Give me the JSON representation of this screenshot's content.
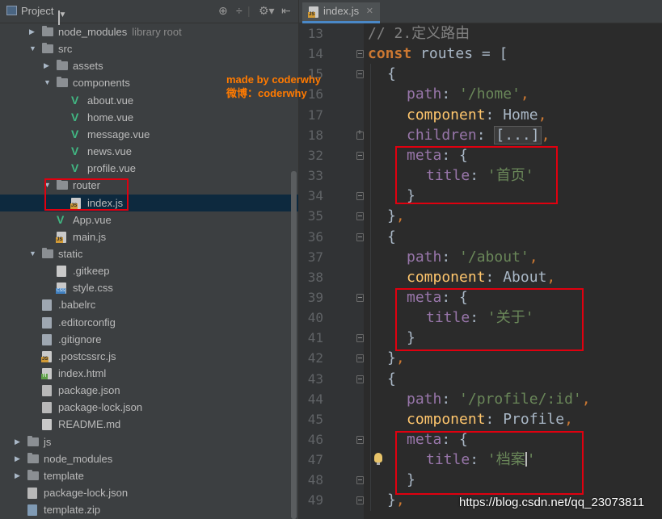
{
  "project": {
    "title": "Project",
    "tree": [
      {
        "label": "node_modules",
        "extra": "library root",
        "type": "folder",
        "depth": 1,
        "expanded": false
      },
      {
        "label": "src",
        "type": "folder",
        "depth": 1,
        "expanded": true
      },
      {
        "label": "assets",
        "type": "folder",
        "depth": 2,
        "expanded": false
      },
      {
        "label": "components",
        "type": "folder",
        "depth": 2,
        "expanded": true
      },
      {
        "label": "about.vue",
        "type": "vue",
        "depth": 3
      },
      {
        "label": "home.vue",
        "type": "vue",
        "depth": 3
      },
      {
        "label": "message.vue",
        "type": "vue",
        "depth": 3
      },
      {
        "label": "news.vue",
        "type": "vue",
        "depth": 3
      },
      {
        "label": "profile.vue",
        "type": "vue",
        "depth": 3
      },
      {
        "label": "router",
        "type": "folder",
        "depth": 2,
        "expanded": true
      },
      {
        "label": "index.js",
        "type": "js",
        "depth": 3,
        "selected": true
      },
      {
        "label": "App.vue",
        "type": "vue",
        "depth": 2
      },
      {
        "label": "main.js",
        "type": "js",
        "depth": 2
      },
      {
        "label": "static",
        "type": "folder",
        "depth": 1,
        "expanded": true
      },
      {
        "label": ".gitkeep",
        "type": "file",
        "depth": 2
      },
      {
        "label": "style.css",
        "type": "css",
        "depth": 2
      },
      {
        "label": ".babelrc",
        "type": "cfg",
        "depth": 1
      },
      {
        "label": ".editorconfig",
        "type": "cfg",
        "depth": 1
      },
      {
        "label": ".gitignore",
        "type": "cfg",
        "depth": 1
      },
      {
        "label": ".postcssrc.js",
        "type": "js",
        "depth": 1
      },
      {
        "label": "index.html",
        "type": "html",
        "depth": 1
      },
      {
        "label": "package.json",
        "type": "json",
        "depth": 1
      },
      {
        "label": "package-lock.json",
        "type": "json",
        "depth": 1
      },
      {
        "label": "README.md",
        "type": "file",
        "depth": 1
      },
      {
        "label": "js",
        "type": "folder",
        "depth": 0,
        "expanded": false
      },
      {
        "label": "node_modules",
        "type": "folder",
        "depth": 0,
        "expanded": false
      },
      {
        "label": "template",
        "type": "folder",
        "depth": 0,
        "expanded": false
      },
      {
        "label": "package-lock.json",
        "type": "json",
        "depth": 0
      },
      {
        "label": "template.zip",
        "type": "zip",
        "depth": 0
      }
    ]
  },
  "editor": {
    "tab_label": "index.js",
    "lines": [
      {
        "num": "13",
        "indent": 0,
        "tokens": [
          {
            "t": "// 2.定义路由",
            "c": "cm"
          }
        ]
      },
      {
        "num": "14",
        "indent": 0,
        "tokens": [
          {
            "t": "const",
            "c": "kw"
          },
          {
            "t": " routes = [",
            "c": "plain"
          }
        ]
      },
      {
        "num": "15",
        "indent": 1,
        "tokens": [
          {
            "t": "{",
            "c": "plain"
          }
        ]
      },
      {
        "num": "16",
        "indent": 2,
        "tokens": [
          {
            "t": "path",
            "c": "prop"
          },
          {
            "t": ": ",
            "c": "plain"
          },
          {
            "t": "'/home'",
            "c": "str"
          },
          {
            "t": ",",
            "c": "punc"
          }
        ]
      },
      {
        "num": "17",
        "indent": 2,
        "tokens": [
          {
            "t": "component",
            "c": "comp"
          },
          {
            "t": ": Home",
            "c": "plain"
          },
          {
            "t": ",",
            "c": "punc"
          }
        ]
      },
      {
        "num": "18",
        "indent": 2,
        "tokens": [
          {
            "t": "children",
            "c": "prop"
          },
          {
            "t": ": ",
            "c": "plain"
          },
          {
            "t": "[...]",
            "c": "collapsed"
          },
          {
            "t": ",",
            "c": "punc"
          }
        ]
      },
      {
        "num": "32",
        "indent": 2,
        "tokens": [
          {
            "t": "meta",
            "c": "prop"
          },
          {
            "t": ": {",
            "c": "plain"
          }
        ]
      },
      {
        "num": "33",
        "indent": 3,
        "tokens": [
          {
            "t": "title",
            "c": "prop"
          },
          {
            "t": ": ",
            "c": "plain"
          },
          {
            "t": "'首页'",
            "c": "str"
          }
        ]
      },
      {
        "num": "34",
        "indent": 2,
        "tokens": [
          {
            "t": "}",
            "c": "plain"
          }
        ]
      },
      {
        "num": "35",
        "indent": 1,
        "tokens": [
          {
            "t": "}",
            "c": "plain"
          },
          {
            "t": ",",
            "c": "punc"
          }
        ]
      },
      {
        "num": "36",
        "indent": 1,
        "tokens": [
          {
            "t": "{",
            "c": "plain"
          }
        ]
      },
      {
        "num": "37",
        "indent": 2,
        "tokens": [
          {
            "t": "path",
            "c": "prop"
          },
          {
            "t": ": ",
            "c": "plain"
          },
          {
            "t": "'/about'",
            "c": "str"
          },
          {
            "t": ",",
            "c": "punc"
          }
        ]
      },
      {
        "num": "38",
        "indent": 2,
        "tokens": [
          {
            "t": "component",
            "c": "comp"
          },
          {
            "t": ": About",
            "c": "plain"
          },
          {
            "t": ",",
            "c": "punc"
          }
        ]
      },
      {
        "num": "39",
        "indent": 2,
        "tokens": [
          {
            "t": "meta",
            "c": "prop"
          },
          {
            "t": ": {",
            "c": "plain"
          }
        ]
      },
      {
        "num": "40",
        "indent": 3,
        "tokens": [
          {
            "t": "title",
            "c": "prop"
          },
          {
            "t": ": ",
            "c": "plain"
          },
          {
            "t": "'关于'",
            "c": "str"
          }
        ]
      },
      {
        "num": "41",
        "indent": 2,
        "tokens": [
          {
            "t": "}",
            "c": "plain"
          }
        ]
      },
      {
        "num": "42",
        "indent": 1,
        "tokens": [
          {
            "t": "}",
            "c": "plain"
          },
          {
            "t": ",",
            "c": "punc"
          }
        ]
      },
      {
        "num": "43",
        "indent": 1,
        "tokens": [
          {
            "t": "{",
            "c": "plain"
          }
        ]
      },
      {
        "num": "44",
        "indent": 2,
        "tokens": [
          {
            "t": "path",
            "c": "prop"
          },
          {
            "t": ": ",
            "c": "plain"
          },
          {
            "t": "'/profile/:id'",
            "c": "str"
          },
          {
            "t": ",",
            "c": "punc"
          }
        ]
      },
      {
        "num": "45",
        "indent": 2,
        "tokens": [
          {
            "t": "component",
            "c": "comp"
          },
          {
            "t": ": Profile",
            "c": "plain"
          },
          {
            "t": ",",
            "c": "punc"
          }
        ]
      },
      {
        "num": "46",
        "indent": 2,
        "tokens": [
          {
            "t": "meta",
            "c": "prop"
          },
          {
            "t": ": {",
            "c": "plain"
          }
        ]
      },
      {
        "num": "47",
        "indent": 3,
        "tokens": [
          {
            "t": "title",
            "c": "prop"
          },
          {
            "t": ": ",
            "c": "plain"
          },
          {
            "t": "'档案",
            "c": "str"
          },
          {
            "t": "CARET",
            "c": "caret"
          },
          {
            "t": "'",
            "c": "str"
          }
        ]
      },
      {
        "num": "48",
        "indent": 2,
        "tokens": [
          {
            "t": "}",
            "c": "plain"
          }
        ]
      },
      {
        "num": "49",
        "indent": 1,
        "tokens": [
          {
            "t": "}",
            "c": "plain"
          },
          {
            "t": ",",
            "c": "punc"
          }
        ]
      }
    ]
  },
  "watermark": {
    "line1": "made by coderwhy",
    "line2": "微博：coderwhy"
  },
  "footer_url": "https://blog.csdn.net/qq_23073811",
  "colors": {
    "highlight_box": "#e0000f",
    "selection": "#0d293e",
    "watermark": "#ff7a00"
  }
}
